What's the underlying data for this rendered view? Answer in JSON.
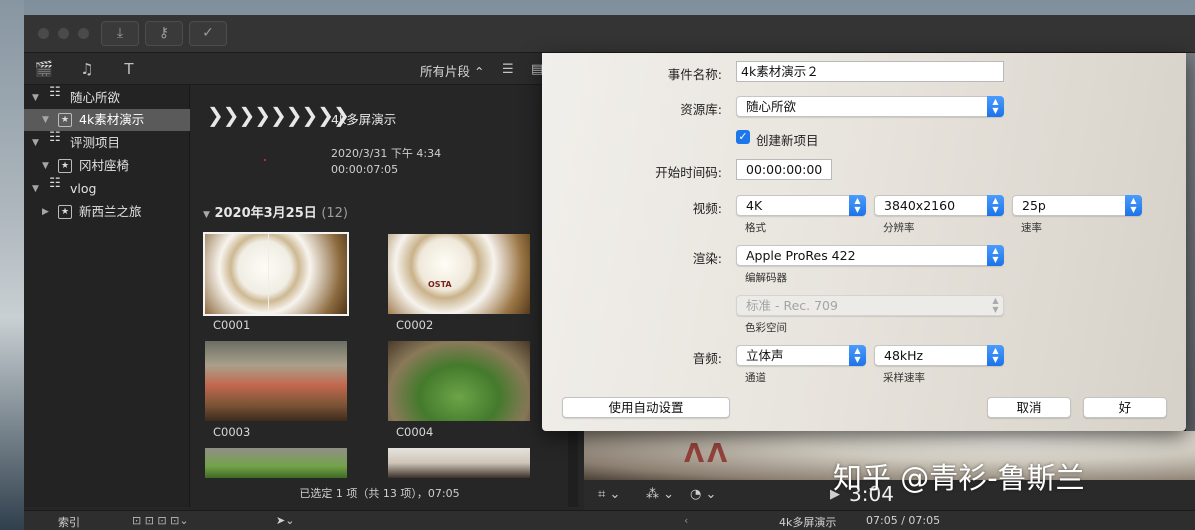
{
  "window": {
    "browser_filter": "所有片段"
  },
  "sidebar": {
    "items": [
      {
        "label": "随心所欲"
      },
      {
        "label": "4k素材演示"
      },
      {
        "label": "评测项目"
      },
      {
        "label": "冈村座椅"
      },
      {
        "label": "vlog"
      },
      {
        "label": "新西兰之旅"
      }
    ]
  },
  "browser": {
    "project_title": "4k多屏演示",
    "project_date": "2020/3/31 下午 4:34",
    "project_duration": "00:00:07:05",
    "date_group": "2020年3月25日",
    "date_group_count": "(12)",
    "clips": [
      {
        "name": "C0001"
      },
      {
        "name": "C0002"
      },
      {
        "name": "C0003"
      },
      {
        "name": "C0004"
      }
    ],
    "status": "已选定 1 项（共 13 项），07:05"
  },
  "viewer": {
    "timecode": "00:00:03:04",
    "timecode_visible": "3:04",
    "watermark": "知乎 @青衫-鲁斯兰"
  },
  "bottombar": {
    "index_label": "索引",
    "project_name": "4k多屏演示",
    "position": "07:05 / 07:05"
  },
  "dialog": {
    "event_name_label": "事件名称:",
    "event_name_value": "4k素材演示２",
    "library_label": "资源库:",
    "library_value": "随心所欲",
    "create_project_label": "创建新项目",
    "start_tc_label": "开始时间码:",
    "start_tc_value": "00:00:00:00",
    "video_label": "视频:",
    "format_value": "4K",
    "format_sub": "格式",
    "resolution_value": "3840x2160",
    "resolution_sub": "分辨率",
    "rate_value": "25p",
    "rate_sub": "速率",
    "render_label": "渲染:",
    "codec_value": "Apple ProRes 422",
    "codec_sub": "编解码器",
    "colorspace_value": "标准 - Rec. 709",
    "colorspace_sub": "色彩空间",
    "audio_label": "音频:",
    "channels_value": "立体声",
    "channels_sub": "通道",
    "samplerate_value": "48kHz",
    "samplerate_sub": "采样速率",
    "auto_settings_label": "使用自动设置",
    "cancel_label": "取消",
    "ok_label": "好"
  },
  "colors": {
    "accent": "#1d76ea",
    "selection": "#5a5a5a"
  }
}
